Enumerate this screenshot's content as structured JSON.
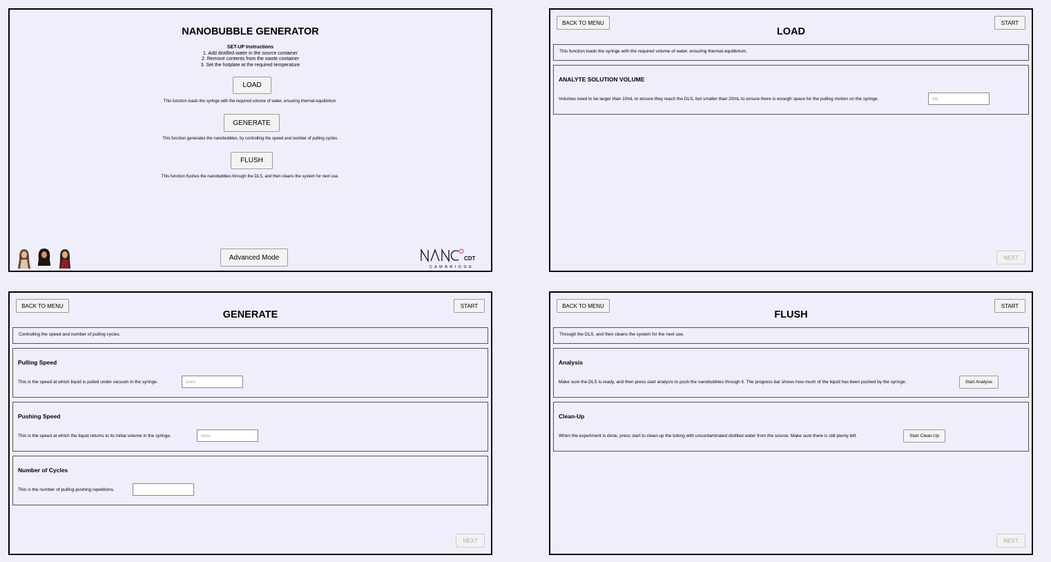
{
  "menu": {
    "title": "NANOBUBBLE GENERATOR",
    "setup_title": "SET-UP Instructions",
    "setup_steps": [
      "1. Add distilled water in the source container",
      "2. Remove contents from the waste container",
      "3. Set the hotplate at the required temperature"
    ],
    "load_label": "LOAD",
    "load_desc": "This function loads the syringe with the required volume of water, ensuring thermal equilibrium.",
    "generate_label": "GENERATE",
    "generate_desc": "This function generates the nanobubbles, by controlling the speed and number of pulling cycles.",
    "flush_label": "FLUSH",
    "flush_desc": "This function flushes the nanobubbles through the DLS, and then cleans the system for next use.",
    "advanced_label": "Advanced Mode",
    "logo_text": "NANO CDT",
    "logo_sub": "C A M B R I D G E"
  },
  "load": {
    "back_label": "BACK TO MENU",
    "start_label": "START",
    "title": "LOAD",
    "desc": "This function loads the syringe with the required volume of water, ensuring thermal equilibrium.",
    "section_title": "ANALYTE SOLUTION VOLUME",
    "section_text": "Volumes need to be larger than 10mL to ensure they reach the DLS, but smaller than 20mL to ensure there is enough space for the pulling motion on the syringe.",
    "volume_placeholder": "mL",
    "next_label": "NEXT"
  },
  "generate": {
    "back_label": "BACK TO MENU",
    "start_label": "START",
    "title": "GENERATE",
    "desc": "Controlling the speed and number of pulling cycles.",
    "pulling_title": "Pulling Speed",
    "pulling_text": "This is the speed at which liquid is pulled under vacuum in the syringe.",
    "pulling_placeholder": "cm/s",
    "pushing_title": "Pushing Speed",
    "pushing_text": "This is the speed at which the liquid returns to its initial volume in the syringe.",
    "pushing_placeholder": "cm/s",
    "cycles_title": "Number of Cycles",
    "cycles_text": "This is the number of pulling-pushing repetitions.",
    "next_label": "NEXT"
  },
  "flush": {
    "back_label": "BACK TO MENU",
    "start_label": "START",
    "title": "FLUSH",
    "desc": "Through the DLS, and then cleans the system for the next use.",
    "analysis_title": "Analysis",
    "analysis_text": "Make sure the DLS is ready, and then press start analysis to push the nanobubbles through it. The progress bar shows how much of the liquid has been pushed by the syringe.",
    "analysis_button": "Start Analysis",
    "cleanup_title": "Clean-Up",
    "cleanup_text": "When the experiment is done, press start to clean-up the tubing with uncontaminated distilled water from the source. Make sure there is still plenty left.",
    "cleanup_button": "Start Clean-Up",
    "next_label": "NEXT"
  },
  "icons": {
    "avatars": [
      "person-avatar-icon",
      "person-avatar-icon",
      "person-avatar-icon"
    ],
    "logo": "nano-cdt-logo"
  },
  "colors": {
    "background": "#f0eff9",
    "panel": "#efeefb",
    "border": "#000000",
    "logo_accent": "#d64a7a"
  }
}
